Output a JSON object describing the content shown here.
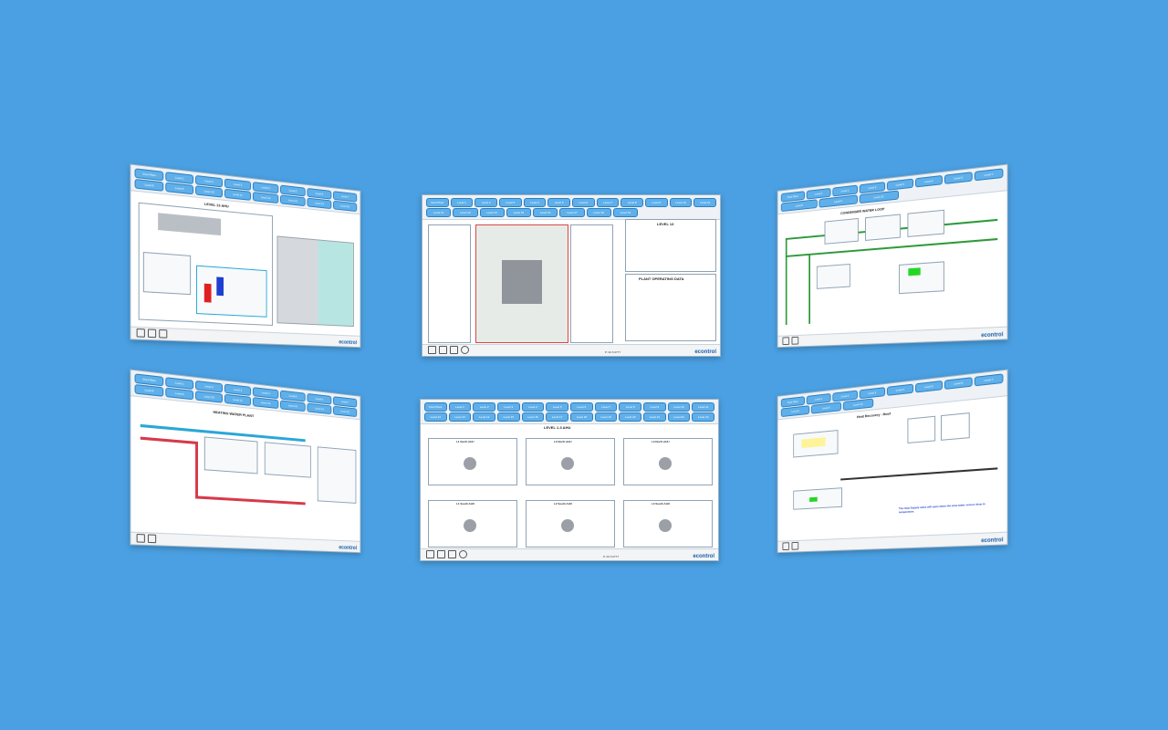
{
  "nav_buttons": [
    "Duct Plant",
    "Level 1",
    "Level 2",
    "Level 3",
    "Level 4",
    "Level 5",
    "Level 6",
    "Level 7",
    "Level 8",
    "Level 9",
    "Level 10",
    "Level 11",
    "Level 12",
    "Level 13",
    "Level 14",
    "Level 15",
    "Level 16",
    "Level 17",
    "Level 18",
    "Level 19",
    "Level 20",
    "Level 21",
    "Level 22",
    "Level 23"
  ],
  "screens": {
    "top_center": {
      "title": "LEVEL 13",
      "sidebar_title": "PLANT OPERATING DATA",
      "buttons": [
        "Trend Data Plot",
        "Plant Alarm"
      ],
      "footer_meta": [
        "Administrator: HAUTE 04/07",
        "Outdoor Temperature: 18.6°C",
        "Outdoor Humidity: 65 %RH"
      ],
      "phone": "P: 02 6 0777",
      "site": "www.econtrol.com.au"
    },
    "bottom_center": {
      "title": "LEVEL 1-3 AHU",
      "units": [
        "L1 North AHU",
        "L2 North AHU",
        "L3 North AHU",
        "L1 South AHU",
        "L2 South AHU",
        "L3 South AHU"
      ],
      "phone": "P: 02 6 0777",
      "site": "www.econtrol.com.au"
    },
    "top_left": {
      "title": "LEVEL 13 AHU",
      "phone": "P: 02 6 0777"
    },
    "top_right": {
      "title": "CONDENSER WATER LOOP",
      "phone": "P: 02 6 0777"
    },
    "bottom_left": {
      "title": "HEATING WATER PLANT",
      "phone": "P: 02 6 0777"
    },
    "bottom_right": {
      "title": "Heat Recovery - Roof",
      "note": "The Heat Supply valve will open when the area water sensor drop in temperature.",
      "phone": "P: 02 6 0777"
    }
  },
  "brand": "econtrol",
  "colors": {
    "background": "#4aa0e2",
    "button": "#5fb0ea",
    "hot_pipe": "#d63a4a",
    "cold_pipe": "#2aa7d6",
    "green_pipe": "#2e9a3a"
  }
}
